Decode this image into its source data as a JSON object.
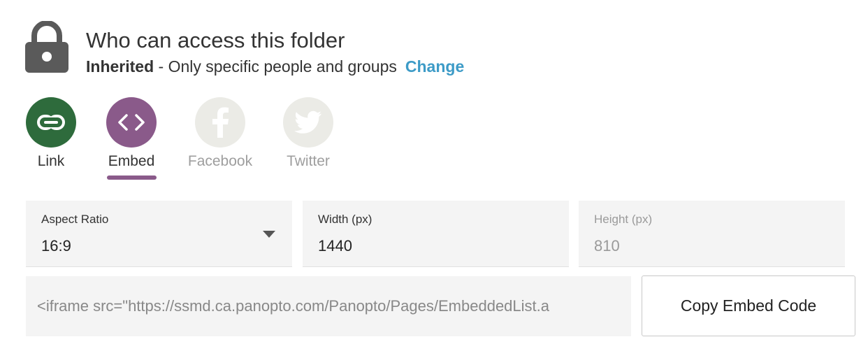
{
  "access": {
    "title": "Who can access this folder",
    "status_bold": "Inherited",
    "status_rest": " - Only specific people and groups",
    "change_label": "Change"
  },
  "share_options": [
    {
      "label": "Link",
      "icon": "link-icon",
      "color": "#2e6b3c",
      "active": false
    },
    {
      "label": "Embed",
      "icon": "code-icon",
      "color": "#8a5a8a",
      "active": true
    },
    {
      "label": "Facebook",
      "icon": "facebook-icon",
      "color": "#ebebe6",
      "active": false
    },
    {
      "label": "Twitter",
      "icon": "twitter-icon",
      "color": "#ebebe6",
      "active": false
    }
  ],
  "fields": {
    "aspect_ratio": {
      "label": "Aspect Ratio",
      "value": "16:9"
    },
    "width": {
      "label": "Width (px)",
      "value": "1440"
    },
    "height": {
      "label": "Height (px)",
      "value": "810"
    }
  },
  "embed": {
    "code": "<iframe src=\"https://ssmd.ca.panopto.com/Panopto/Pages/EmbeddedList.a",
    "copy_label": "Copy Embed Code"
  },
  "colors": {
    "accent_link": "#3d9bc7",
    "selected_underline": "#8a5a8a"
  }
}
